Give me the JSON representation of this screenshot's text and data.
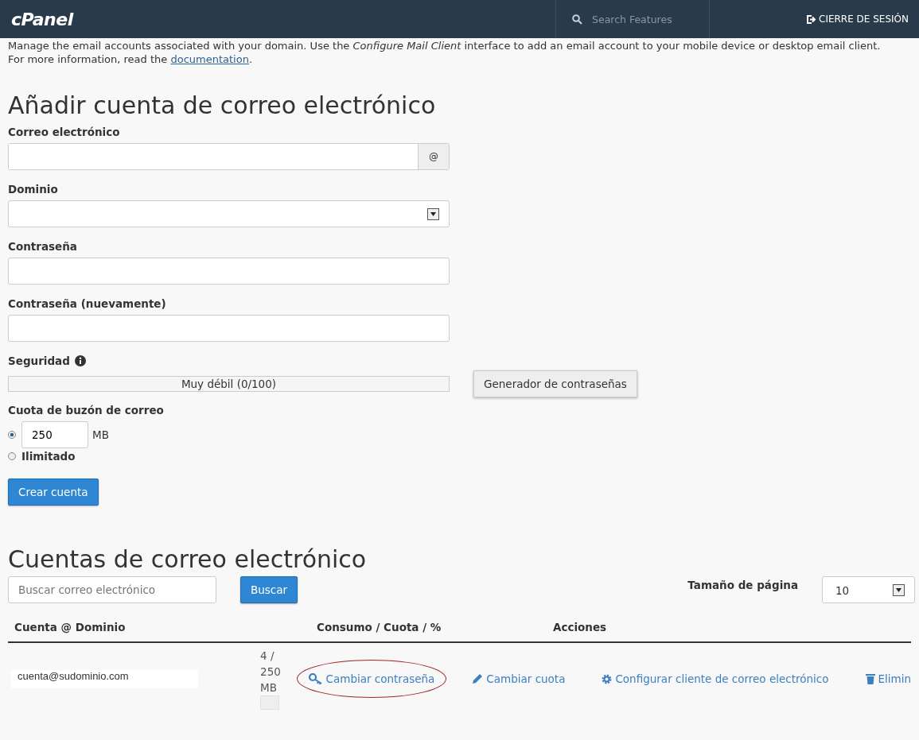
{
  "header": {
    "logo": "cPanel",
    "search": {
      "placeholder": "Search Features"
    },
    "logout": "CIERRE DE SESIÓN"
  },
  "intro": {
    "text": "Manage the email accounts associated with your domain. Use the *Configure Mail Client* interface to add an email account to your mobile device or desktop email client.",
    "more": "For more information, read the",
    "link": "documentation",
    "end": "."
  },
  "add_form": {
    "title": "Añadir cuenta de correo electrónico",
    "email": {
      "label": "Correo electrónico",
      "addon": "@"
    },
    "domain": {
      "label": "Dominio"
    },
    "password": {
      "label": "Contraseña"
    },
    "password_again": {
      "label": "Contraseña (nuevamente)"
    },
    "security": {
      "label": "Seguridad",
      "reading": "Muy débil (0/100)",
      "generator": "Generador de contraseñas"
    },
    "quota": {
      "label": "Cuota de buzón de correo",
      "options": [
        {
          "kind": "amount",
          "value": "250",
          "unit": "MB",
          "selected": true
        },
        {
          "kind": "label",
          "label": "Ilimitado",
          "selected": false
        }
      ]
    },
    "submit": "Crear cuenta"
  },
  "accounts": {
    "title": "Cuentas de correo electrónico",
    "search": {
      "placeholder": "Buscar correo electrónico"
    },
    "search_button": "Buscar",
    "page_size": {
      "label": "Tamaño de página",
      "value": "10"
    },
    "columns": [
      "Cuenta @ Dominio",
      "Consumo / Cuota / %",
      "Acciones"
    ],
    "rows": [
      {
        "account": "cuenta@sudominio.com",
        "usage": [
          "4 /",
          "250",
          "MB"
        ],
        "actions": [
          {
            "kind": "key",
            "label": "Cambiar contraseña",
            "circled": true
          },
          {
            "kind": "pencil",
            "label": "Cambiar cuota",
            "circled": false
          },
          {
            "kind": "gear",
            "label": "Configurar cliente de correo electrónico",
            "circled": false
          },
          {
            "kind": "trash",
            "label": "Elimin",
            "circled": false
          }
        ]
      }
    ]
  }
}
